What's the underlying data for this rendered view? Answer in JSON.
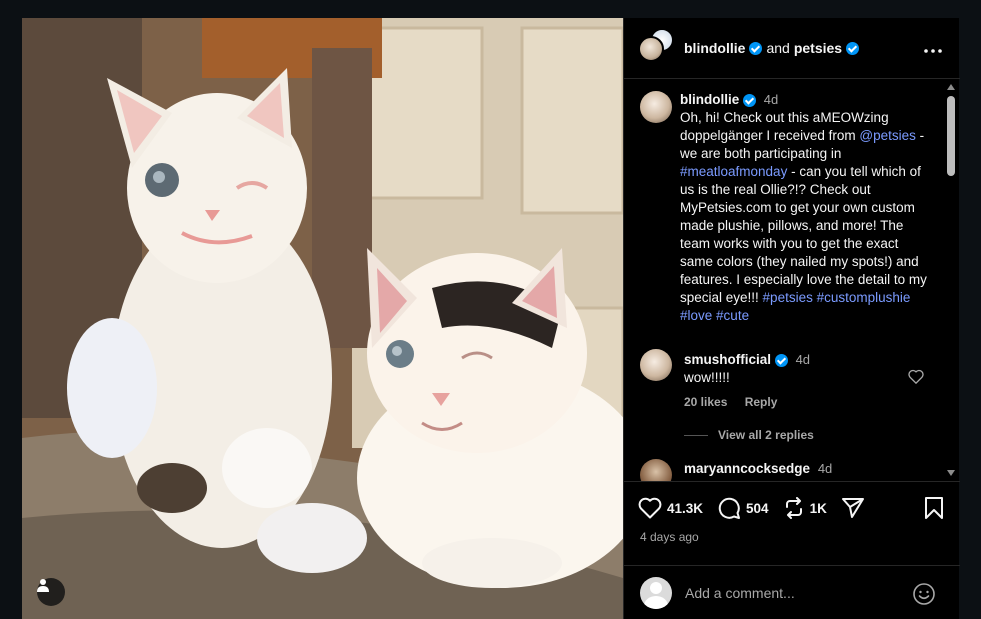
{
  "post": {
    "header": {
      "author": "blindollie",
      "connector": "and",
      "collaborator": "petsies"
    },
    "caption": {
      "username": "blindollie",
      "time": "4d",
      "parts": [
        {
          "text": "Oh, hi! Check out this aMEOWzing doppelgänger I received from ",
          "link": false
        },
        {
          "text": "@petsies",
          "link": true
        },
        {
          "text": " - we are both participating in ",
          "link": false
        },
        {
          "text": "#meatloafmonday",
          "link": true
        },
        {
          "text": " - can you tell which of us is the real Ollie?!? Check out MyPetsies.com to get your own custom made plushie, pillows, and more! The team works with you to get the exact same colors (they nailed my spots!) and features. I especially love the detail to my special eye!!! ",
          "link": false
        },
        {
          "text": "#petsies",
          "link": true
        },
        {
          "text": " ",
          "link": false
        },
        {
          "text": "#customplushie",
          "link": true
        },
        {
          "text": " ",
          "link": false
        },
        {
          "text": "#love",
          "link": true
        },
        {
          "text": " ",
          "link": false
        },
        {
          "text": "#cute",
          "link": true
        }
      ]
    },
    "comments": [
      {
        "username": "smushofficial",
        "time": "4d",
        "text": "wow!!!!!",
        "likes": "20 likes",
        "reply": "Reply",
        "view_replies": "View all 2 replies"
      },
      {
        "username": "maryanncocksedge",
        "time": "4d"
      }
    ],
    "actions": {
      "likes": "41.3K",
      "comments": "504",
      "reposts": "1K"
    },
    "posted_ago": "4 days ago",
    "add_comment_placeholder": "Add a comment..."
  },
  "colors": {
    "background": "#0c1014",
    "panel": "#000000",
    "link": "#7b9bff",
    "verified": "#0095f6",
    "muted": "#a8a8a8"
  },
  "icons": [
    "user-tag-icon",
    "verified-icon",
    "more-icon",
    "heart-icon",
    "comment-icon",
    "repost-icon",
    "share-icon",
    "bookmark-icon",
    "emoji-icon"
  ]
}
